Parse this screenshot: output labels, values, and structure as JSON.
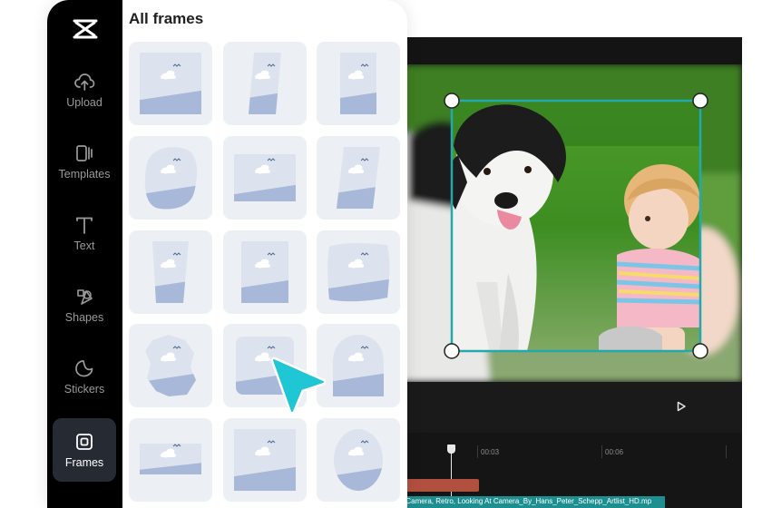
{
  "app": {
    "brand": "CapCut",
    "logo_icon": "capcut-logo-icon"
  },
  "sidebar": {
    "items": [
      {
        "label": "Upload",
        "icon": "upload-cloud-icon",
        "active": false
      },
      {
        "label": "Templates",
        "icon": "templates-icon",
        "active": false
      },
      {
        "label": "Text",
        "icon": "text-icon",
        "active": false
      },
      {
        "label": "Shapes",
        "icon": "shapes-icon",
        "active": false
      },
      {
        "label": "Stickers",
        "icon": "stickers-icon",
        "active": false
      },
      {
        "label": "Frames",
        "icon": "frames-icon",
        "active": true
      }
    ]
  },
  "frames_panel": {
    "title": "All frames",
    "frame_shapes": [
      "rectangle",
      "slanted-narrow",
      "tall-rectangle",
      "blob",
      "wide-rectangle",
      "trapezoid",
      "trapezoid-narrow",
      "square",
      "wavy-rectangle",
      "irregular-blob",
      "rounded-rectangle",
      "arch",
      "panorama-strip",
      "square-large",
      "oval"
    ]
  },
  "editor": {
    "timeline": {
      "ticks": [
        "00:03",
        "00:06"
      ],
      "clip_name": "an, Camera, Retro, Looking At Camera_By_Hans_Peter_Schepp_Artlist_HD.mp"
    },
    "play_icon": "play-icon"
  },
  "colors": {
    "accent": "#1fc6d4",
    "selection": "#23a9ad",
    "sidebar_bg": "#000000",
    "tile_bg": "#eceff3",
    "frame_fill": "#a8b8d8",
    "audio_clip": "#b2503f",
    "video_clip": "#1d8f91"
  }
}
